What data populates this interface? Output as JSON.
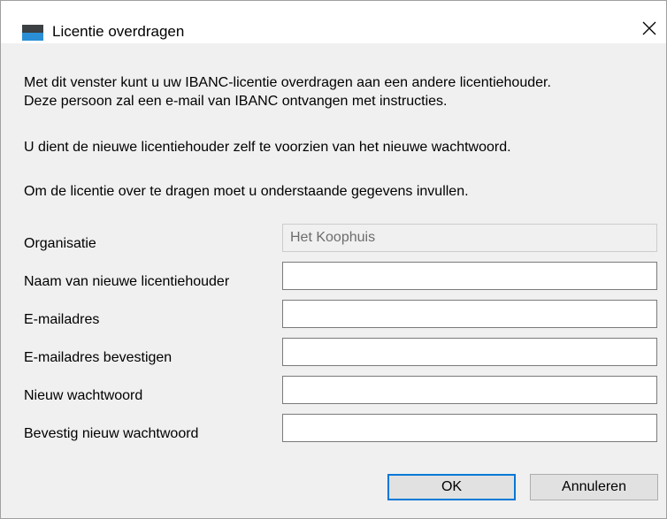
{
  "window": {
    "title": "Licentie overdragen",
    "close_icon": "close-icon"
  },
  "intro": {
    "line1": "Met dit venster kunt u uw IBANC-licentie overdragen aan een andere licentiehouder.",
    "line2": "Deze persoon zal een e-mail van IBANC ontvangen met instructies.",
    "line3": "U dient de nieuwe licentiehouder zelf te voorzien van het nieuwe wachtwoord.",
    "line4": "Om de licentie over te dragen moet u onderstaande gegevens invullen."
  },
  "fields": {
    "organisation": {
      "label": "Organisatie",
      "value": "Het Koophuis",
      "disabled": true
    },
    "new_holder_name": {
      "label": "Naam van nieuwe licentiehouder",
      "value": ""
    },
    "email": {
      "label": "E-mailadres",
      "value": ""
    },
    "email_confirm": {
      "label": "E-mailadres bevestigen",
      "value": ""
    },
    "new_password": {
      "label": "Nieuw wachtwoord",
      "value": ""
    },
    "confirm_password": {
      "label": "Bevestig nieuw wachtwoord",
      "value": ""
    }
  },
  "buttons": {
    "ok": "OK",
    "cancel": "Annuleren"
  },
  "colors": {
    "accent": "#0078d7",
    "icon_dark": "#3c4043",
    "icon_blue": "#2b8fd6"
  }
}
